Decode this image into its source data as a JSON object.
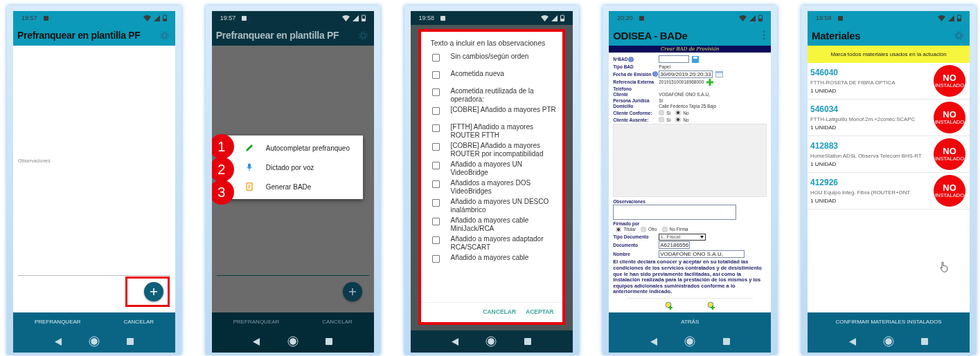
{
  "phones": [
    {
      "kind": "form",
      "status_time": "19:57",
      "title": "Prefranquear en plantilla PF",
      "field_label": "Observaciones",
      "fab_highlighted": true,
      "actions": [
        "PREFRANQUEAR",
        "CANCELAR"
      ]
    },
    {
      "kind": "menu",
      "status_time": "19:57",
      "title": "Prefranquear en plantilla PF",
      "actions": [
        "PREFRANQUEAR",
        "CANCELAR"
      ],
      "menu": [
        {
          "number": "1",
          "kind": "pencil",
          "label": "Autocompletar prefranqueo"
        },
        {
          "number": "2",
          "kind": "microphone",
          "label": "Dictado por voz"
        },
        {
          "number": "3",
          "kind": "document",
          "label": "Generar BADe"
        }
      ]
    },
    {
      "kind": "dialog",
      "status_time": "19:58",
      "dialog": {
        "title": "Texto a incluir en las observaciones",
        "highlighted": true,
        "options": [
          {
            "label": "Sin cambios/según orden",
            "checked": false
          },
          {
            "label": "Acometida nueva",
            "checked": false
          },
          {
            "label": "Acometida reutilizada de la operadora:",
            "checked": false
          },
          {
            "label": "[COBRE] Añadido a mayores PTR",
            "checked": false
          },
          {
            "label": "[FTTH] Añadido a mayores ROUTER FTTH",
            "checked": false
          },
          {
            "label": "[COBRE] Añadido a mayores ROUTER por incompatibilidad",
            "checked": false
          },
          {
            "label": "Añadido a mayores UN VideoBridge",
            "checked": false
          },
          {
            "label": "Añadidos a mayores DOS VideoBridges",
            "checked": false
          },
          {
            "label": "Añadido a mayores UN DESCO inalámbrico",
            "checked": false
          },
          {
            "label": "Añadido a mayores cable MiniJack/RCA",
            "checked": false
          },
          {
            "label": "Añadido a mayores adaptador RCA/SCART",
            "checked": false
          },
          {
            "label": "Añadido a mayores cable",
            "checked": false
          }
        ],
        "buttons": [
          "CANCELAR",
          "ACEPTAR"
        ]
      }
    },
    {
      "kind": "bad",
      "status_time": "20:20",
      "title": "ODISEA - BADe",
      "banner": "Crear BAD de Provisión",
      "fields": [
        {
          "kind": "input",
          "label": "NºBAD"
        },
        {
          "kind": "text",
          "label": "Tipo BAD",
          "value": "Papel"
        },
        {
          "kind": "input",
          "label": "Fecha de Emisión",
          "value": "30/09/2019 20:20:33"
        },
        {
          "kind": "text",
          "label": "Referencia Externa",
          "value": "201915100018968000"
        },
        {
          "kind": "text",
          "label": "Teléfono"
        },
        {
          "kind": "text",
          "label": "Cliente",
          "value": "VODAFONE ONO S.A.U,"
        },
        {
          "kind": "text",
          "label": "Persona Jurídica",
          "value": "Sí"
        },
        {
          "kind": "text",
          "label": "Domicilio",
          "value": "Calle Federico Tapia 25 Bajo"
        },
        {
          "kind": "radio",
          "label": "Cliente Conforme:",
          "options": [
            {
              "label": "Sí",
              "selected": false
            },
            {
              "label": "No",
              "selected": true
            }
          ]
        },
        {
          "kind": "radio",
          "label": "Cliente Ausente:",
          "options": [
            {
              "label": "Sí",
              "selected": false
            },
            {
              "label": "No",
              "selected": true
            }
          ]
        }
      ],
      "observations_label": "Observaciones",
      "signed_label": "Firmado por",
      "signed_options": [
        {
          "label": "Titular",
          "selected": true
        },
        {
          "label": "Otro",
          "selected": false
        },
        {
          "label": "No Firma",
          "selected": false
        }
      ],
      "doc_fields": [
        {
          "kind": "select",
          "label": "Tipo Documento",
          "value": "L. Fiscal"
        },
        {
          "kind": "input",
          "label": "Documento",
          "value": "A62186556"
        },
        {
          "kind": "input",
          "label": "Nombre",
          "value": "VODAFONE ONO S.A.U,"
        }
      ],
      "declaration": "El cliente declara conocer y aceptar en su totalidad las condiciones de los servicios contratados y de desistimiento que le han sido previamente facilitadas, así como la instalación realizada para la prestación de los mismos y los equipos adicionales suministrados conforme a lo anteriormente indicado.",
      "actions": [
        "ATRÁS"
      ]
    },
    {
      "kind": "materials",
      "status_time": "19:58",
      "title": "Materiales",
      "notice": "Marca todos materiales usados en la actuación",
      "items": [
        {
          "code": "546040",
          "name": "FTTH-ROSETA DE FIBRA OPTICA",
          "quantity": "1 UNIDAD",
          "badge": "NO",
          "badge_caption": "INSTALADO"
        },
        {
          "code": "546034",
          "name": "FTTH-Latiguillo Monof.2m.+2conec.SCAPC",
          "quantity": "1 UNIDAD",
          "badge": "NO",
          "badge_caption": "INSTALADO"
        },
        {
          "code": "412883",
          "name": "HomeStation ADSL Observa Telecom BHS-RT",
          "quantity": "1 UNIDAD",
          "badge": "NO",
          "badge_caption": "INSTALADO"
        },
        {
          "code": "412926",
          "name": "HGU Equipo Integ. Fibra (ROUTER+ONT",
          "quantity": "1 UNIDAD",
          "badge": "NO",
          "badge_caption": "INSTALADO"
        }
      ],
      "actions": [
        "CONFIRMAR MATERIALES INSTALADOS"
      ]
    }
  ]
}
